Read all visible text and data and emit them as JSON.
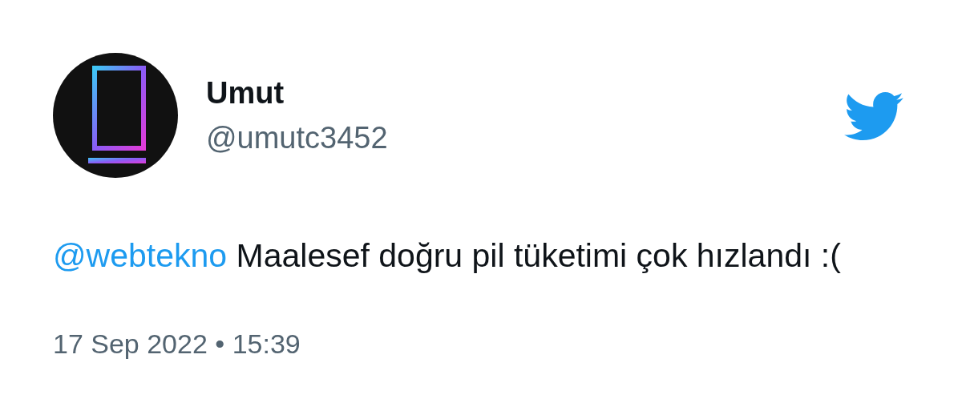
{
  "author": {
    "name": "Umut",
    "handle": "@umutc3452"
  },
  "tweet": {
    "mention": "@webtekno",
    "text": " Maalesef doğru pil tüketimi çok hızlandı :(",
    "timestamp": "17 Sep 2022 • 15:39"
  }
}
